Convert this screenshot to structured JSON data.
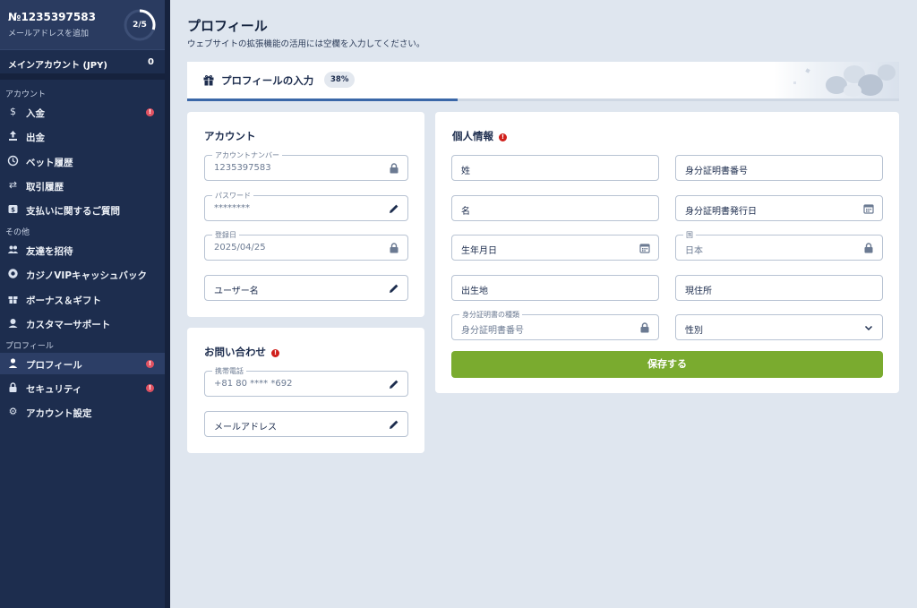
{
  "sidebar": {
    "account_number": "№1235397583",
    "account_sub": "メールアドレスを追加",
    "progress_ring": "2/5",
    "main_account_label": "メインアカウント (JPY)",
    "main_account_value": "0",
    "sections": {
      "account": "アカウント",
      "other": "その他",
      "profile": "プロフィール"
    },
    "items": [
      {
        "label": "入金",
        "icon": "dollar-icon",
        "badge": "!"
      },
      {
        "label": "出金",
        "icon": "upload-icon"
      },
      {
        "label": "ベット履歴",
        "icon": "clock-icon"
      },
      {
        "label": "取引履歴",
        "icon": "arrows-icon"
      },
      {
        "label": "支払いに関するご質問",
        "icon": "payment-help-icon"
      },
      {
        "label": "友達を招待",
        "icon": "friends-icon"
      },
      {
        "label": "カジノVIPキャッシュバック",
        "icon": "casino-chip-icon"
      },
      {
        "label": "ボーナス＆ギフト",
        "icon": "gift-icon"
      },
      {
        "label": "カスタマーサポート",
        "icon": "support-icon"
      },
      {
        "label": "プロフィール",
        "icon": "user-icon",
        "badge": "!",
        "active": true
      },
      {
        "label": "セキュリティ",
        "icon": "lock-icon",
        "badge": "!"
      },
      {
        "label": "アカウント設定",
        "icon": "gear-icon"
      }
    ]
  },
  "main": {
    "title": "プロフィール",
    "subtitle": "ウェブサイトの拡張機能の活用には空欄を入力してください。",
    "progress": {
      "label": "プロフィールの入力",
      "percent_text": "38%",
      "fraction": 0.38
    }
  },
  "account_card": {
    "title": "アカウント",
    "account_number_label": "アカウントナンバー",
    "account_number_value": "1235397583",
    "password_label": "パスワード",
    "password_value": "********",
    "registered_label": "登録日",
    "registered_value": "2025/04/25",
    "username_placeholder": "ユーザー名"
  },
  "contact_card": {
    "title": "お問い合わせ",
    "warn": "!",
    "phone_label": "携帯電話",
    "phone_value": "+81 80 **** *692",
    "email_placeholder": "メールアドレス"
  },
  "personal_card": {
    "title": "個人情報",
    "warn": "!",
    "last_name": "姓",
    "id_number": "身分証明書番号",
    "first_name": "名",
    "id_issue_date": "身分証明書発行日",
    "birth_date": "生年月日",
    "country_label": "国",
    "country_value": "日本",
    "birth_place": "出生地",
    "current_address": "現住所",
    "id_type_label": "身分証明書の種類",
    "id_type_value": "身分証明書番号",
    "gender": "性別",
    "save_button": "保存する"
  },
  "colors": {
    "sidebar_bg": "#1d2d4e",
    "accent_blue": "#3a67a8",
    "save_green": "#7aab2f",
    "badge_red": "#e05262",
    "warn_red": "#d0201c"
  }
}
